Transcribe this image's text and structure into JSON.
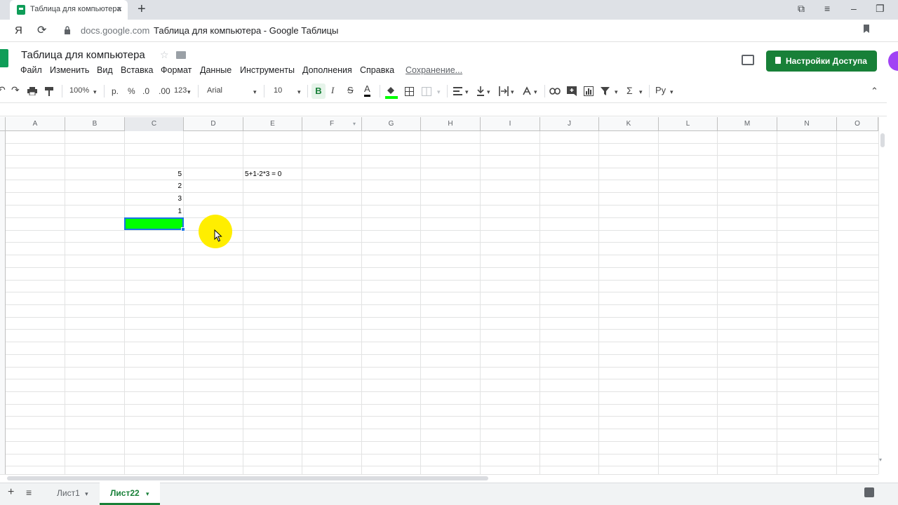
{
  "browser": {
    "tab_title": "Таблица для компьютера",
    "tab_close": "×",
    "new_tab": "+",
    "yandex_button": "Я",
    "reload_icon": "⟳",
    "domain": "docs.google.com",
    "page_title": "Таблица для компьютера - Google Таблицы",
    "window_controls": [
      "⧉",
      "≡",
      "–",
      "❐"
    ]
  },
  "header": {
    "doc_title": "Таблица для компьютера",
    "star": "☆",
    "menu": [
      "Файл",
      "Изменить",
      "Вид",
      "Вставка",
      "Формат",
      "Данные",
      "Инструменты",
      "Дополнения",
      "Справка"
    ],
    "saving": "Сохранение...",
    "share_label": "Настройки Доступа",
    "share_color": "#188038"
  },
  "toolbar": {
    "undo": "↶",
    "redo": "↷",
    "zoom": "100%",
    "currency": "р.",
    "percent": "%",
    "dec_decrease": ".0",
    "dec_increase": ".00",
    "number_format": "123",
    "font": "Arial",
    "font_size": "10",
    "bold": "B",
    "italic": "I",
    "strike": "S",
    "text_color": "A",
    "input_tools": "Ру",
    "collapse": "⌃"
  },
  "grid": {
    "columns": [
      "A",
      "B",
      "C",
      "D",
      "E",
      "F",
      "G",
      "H",
      "I",
      "J",
      "K",
      "L",
      "M",
      "N",
      "O"
    ],
    "selected_column": "C",
    "cells": {
      "c3": "5",
      "c4": "2",
      "c5": "3",
      "c6": "1",
      "e3": "5+1-2*3 = 0"
    },
    "selected_fill": "#00ff00",
    "cursor_highlight": "#ffee00"
  },
  "sheets": {
    "add": "+",
    "list": "≡",
    "tabs": [
      "Лист1",
      "Лист22"
    ],
    "active_tab": "Лист22",
    "dropdown": "▾"
  }
}
